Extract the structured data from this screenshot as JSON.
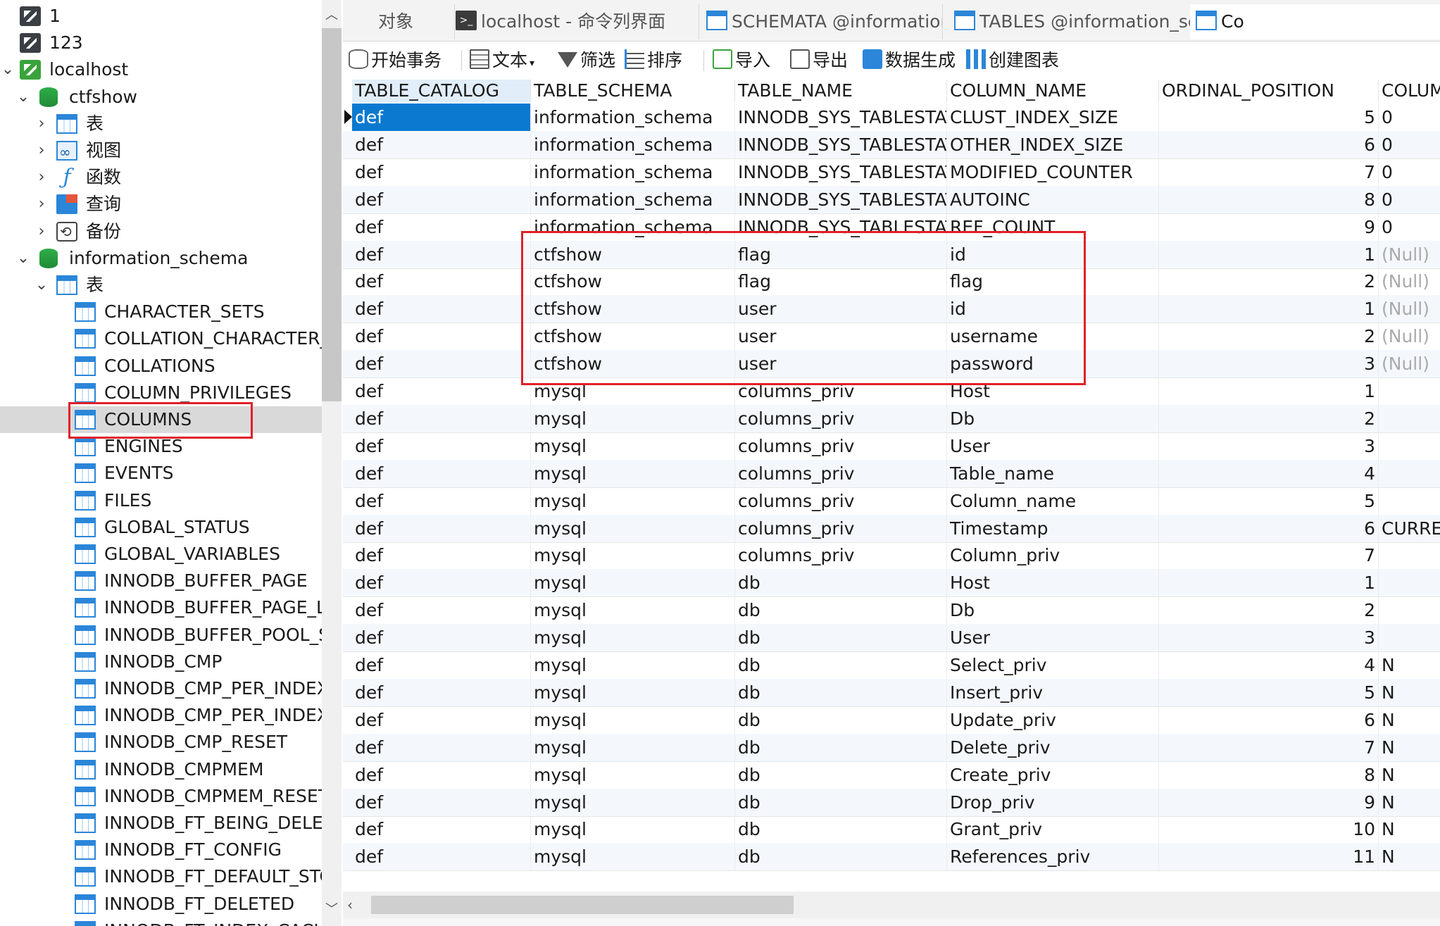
{
  "sidebar": {
    "connections": [
      {
        "label": "1"
      },
      {
        "label": "123"
      },
      {
        "label": "localhost"
      }
    ],
    "databases": [
      {
        "label": "ctfshow"
      },
      {
        "label": "information_schema"
      }
    ],
    "ctfshow_children": [
      "表",
      "视图",
      "函数",
      "查询",
      "备份"
    ],
    "info_tables_folder": "表",
    "tables": [
      "CHARACTER_SETS",
      "COLLATION_CHARACTER_S",
      "COLLATIONS",
      "COLUMN_PRIVILEGES",
      "COLUMNS",
      "ENGINES",
      "EVENTS",
      "FILES",
      "GLOBAL_STATUS",
      "GLOBAL_VARIABLES",
      "INNODB_BUFFER_PAGE",
      "INNODB_BUFFER_PAGE_LR",
      "INNODB_BUFFER_POOL_ST",
      "INNODB_CMP",
      "INNODB_CMP_PER_INDEX",
      "INNODB_CMP_PER_INDEX_",
      "INNODB_CMP_RESET",
      "INNODB_CMPMEM",
      "INNODB_CMPMEM_RESET",
      "INNODB_FT_BEING_DELETI",
      "INNODB_FT_CONFIG",
      "INNODB_FT_DEFAULT_STC",
      "INNODB_FT_DELETED",
      "INNODB_FT_INDEX_CACHI"
    ],
    "selected_table": "COLUMNS"
  },
  "tabs": [
    {
      "label": "对象"
    },
    {
      "label": "localhost - 命令列界面"
    },
    {
      "label": "SCHEMATA @information_sche..."
    },
    {
      "label": "TABLES @information_schema (l..."
    },
    {
      "label": "Co"
    }
  ],
  "toolbar": {
    "begin_tx": "开始事务",
    "text": "文本",
    "filter": "筛选",
    "sort": "排序",
    "import": "导入",
    "export": "导出",
    "data_gen": "数据生成",
    "create_chart": "创建图表"
  },
  "grid": {
    "columns": [
      "TABLE_CATALOG",
      "TABLE_SCHEMA",
      "TABLE_NAME",
      "COLUMN_NAME",
      "ORDINAL_POSITION",
      "COLUM"
    ],
    "rows": [
      [
        "def",
        "information_schema",
        "INNODB_SYS_TABLESTATS",
        "CLUST_INDEX_SIZE",
        "5",
        "0"
      ],
      [
        "def",
        "information_schema",
        "INNODB_SYS_TABLESTATS",
        "OTHER_INDEX_SIZE",
        "6",
        "0"
      ],
      [
        "def",
        "information_schema",
        "INNODB_SYS_TABLESTATS",
        "MODIFIED_COUNTER",
        "7",
        "0"
      ],
      [
        "def",
        "information_schema",
        "INNODB_SYS_TABLESTATS",
        "AUTOINC",
        "8",
        "0"
      ],
      [
        "def",
        "information_schema",
        "INNODB_SYS_TABLESTATS",
        "REF_COUNT",
        "9",
        "0"
      ],
      [
        "def",
        "ctfshow",
        "flag",
        "id",
        "1",
        "(Null)"
      ],
      [
        "def",
        "ctfshow",
        "flag",
        "flag",
        "2",
        "(Null)"
      ],
      [
        "def",
        "ctfshow",
        "user",
        "id",
        "1",
        "(Null)"
      ],
      [
        "def",
        "ctfshow",
        "user",
        "username",
        "2",
        "(Null)"
      ],
      [
        "def",
        "ctfshow",
        "user",
        "password",
        "3",
        "(Null)"
      ],
      [
        "def",
        "mysql",
        "columns_priv",
        "Host",
        "1",
        ""
      ],
      [
        "def",
        "mysql",
        "columns_priv",
        "Db",
        "2",
        ""
      ],
      [
        "def",
        "mysql",
        "columns_priv",
        "User",
        "3",
        ""
      ],
      [
        "def",
        "mysql",
        "columns_priv",
        "Table_name",
        "4",
        ""
      ],
      [
        "def",
        "mysql",
        "columns_priv",
        "Column_name",
        "5",
        ""
      ],
      [
        "def",
        "mysql",
        "columns_priv",
        "Timestamp",
        "6",
        "CURRENT"
      ],
      [
        "def",
        "mysql",
        "columns_priv",
        "Column_priv",
        "7",
        ""
      ],
      [
        "def",
        "mysql",
        "db",
        "Host",
        "1",
        ""
      ],
      [
        "def",
        "mysql",
        "db",
        "Db",
        "2",
        ""
      ],
      [
        "def",
        "mysql",
        "db",
        "User",
        "3",
        ""
      ],
      [
        "def",
        "mysql",
        "db",
        "Select_priv",
        "4",
        "N"
      ],
      [
        "def",
        "mysql",
        "db",
        "Insert_priv",
        "5",
        "N"
      ],
      [
        "def",
        "mysql",
        "db",
        "Update_priv",
        "6",
        "N"
      ],
      [
        "def",
        "mysql",
        "db",
        "Delete_priv",
        "7",
        "N"
      ],
      [
        "def",
        "mysql",
        "db",
        "Create_priv",
        "8",
        "N"
      ],
      [
        "def",
        "mysql",
        "db",
        "Drop_priv",
        "9",
        "N"
      ],
      [
        "def",
        "mysql",
        "db",
        "Grant_priv",
        "10",
        "N"
      ],
      [
        "def",
        "mysql",
        "db",
        "References_priv",
        "11",
        "N"
      ]
    ]
  },
  "colors": {
    "selection": "#0b79d0",
    "highlight_box": "#e0202a",
    "null_text": "#aaaaaa"
  }
}
